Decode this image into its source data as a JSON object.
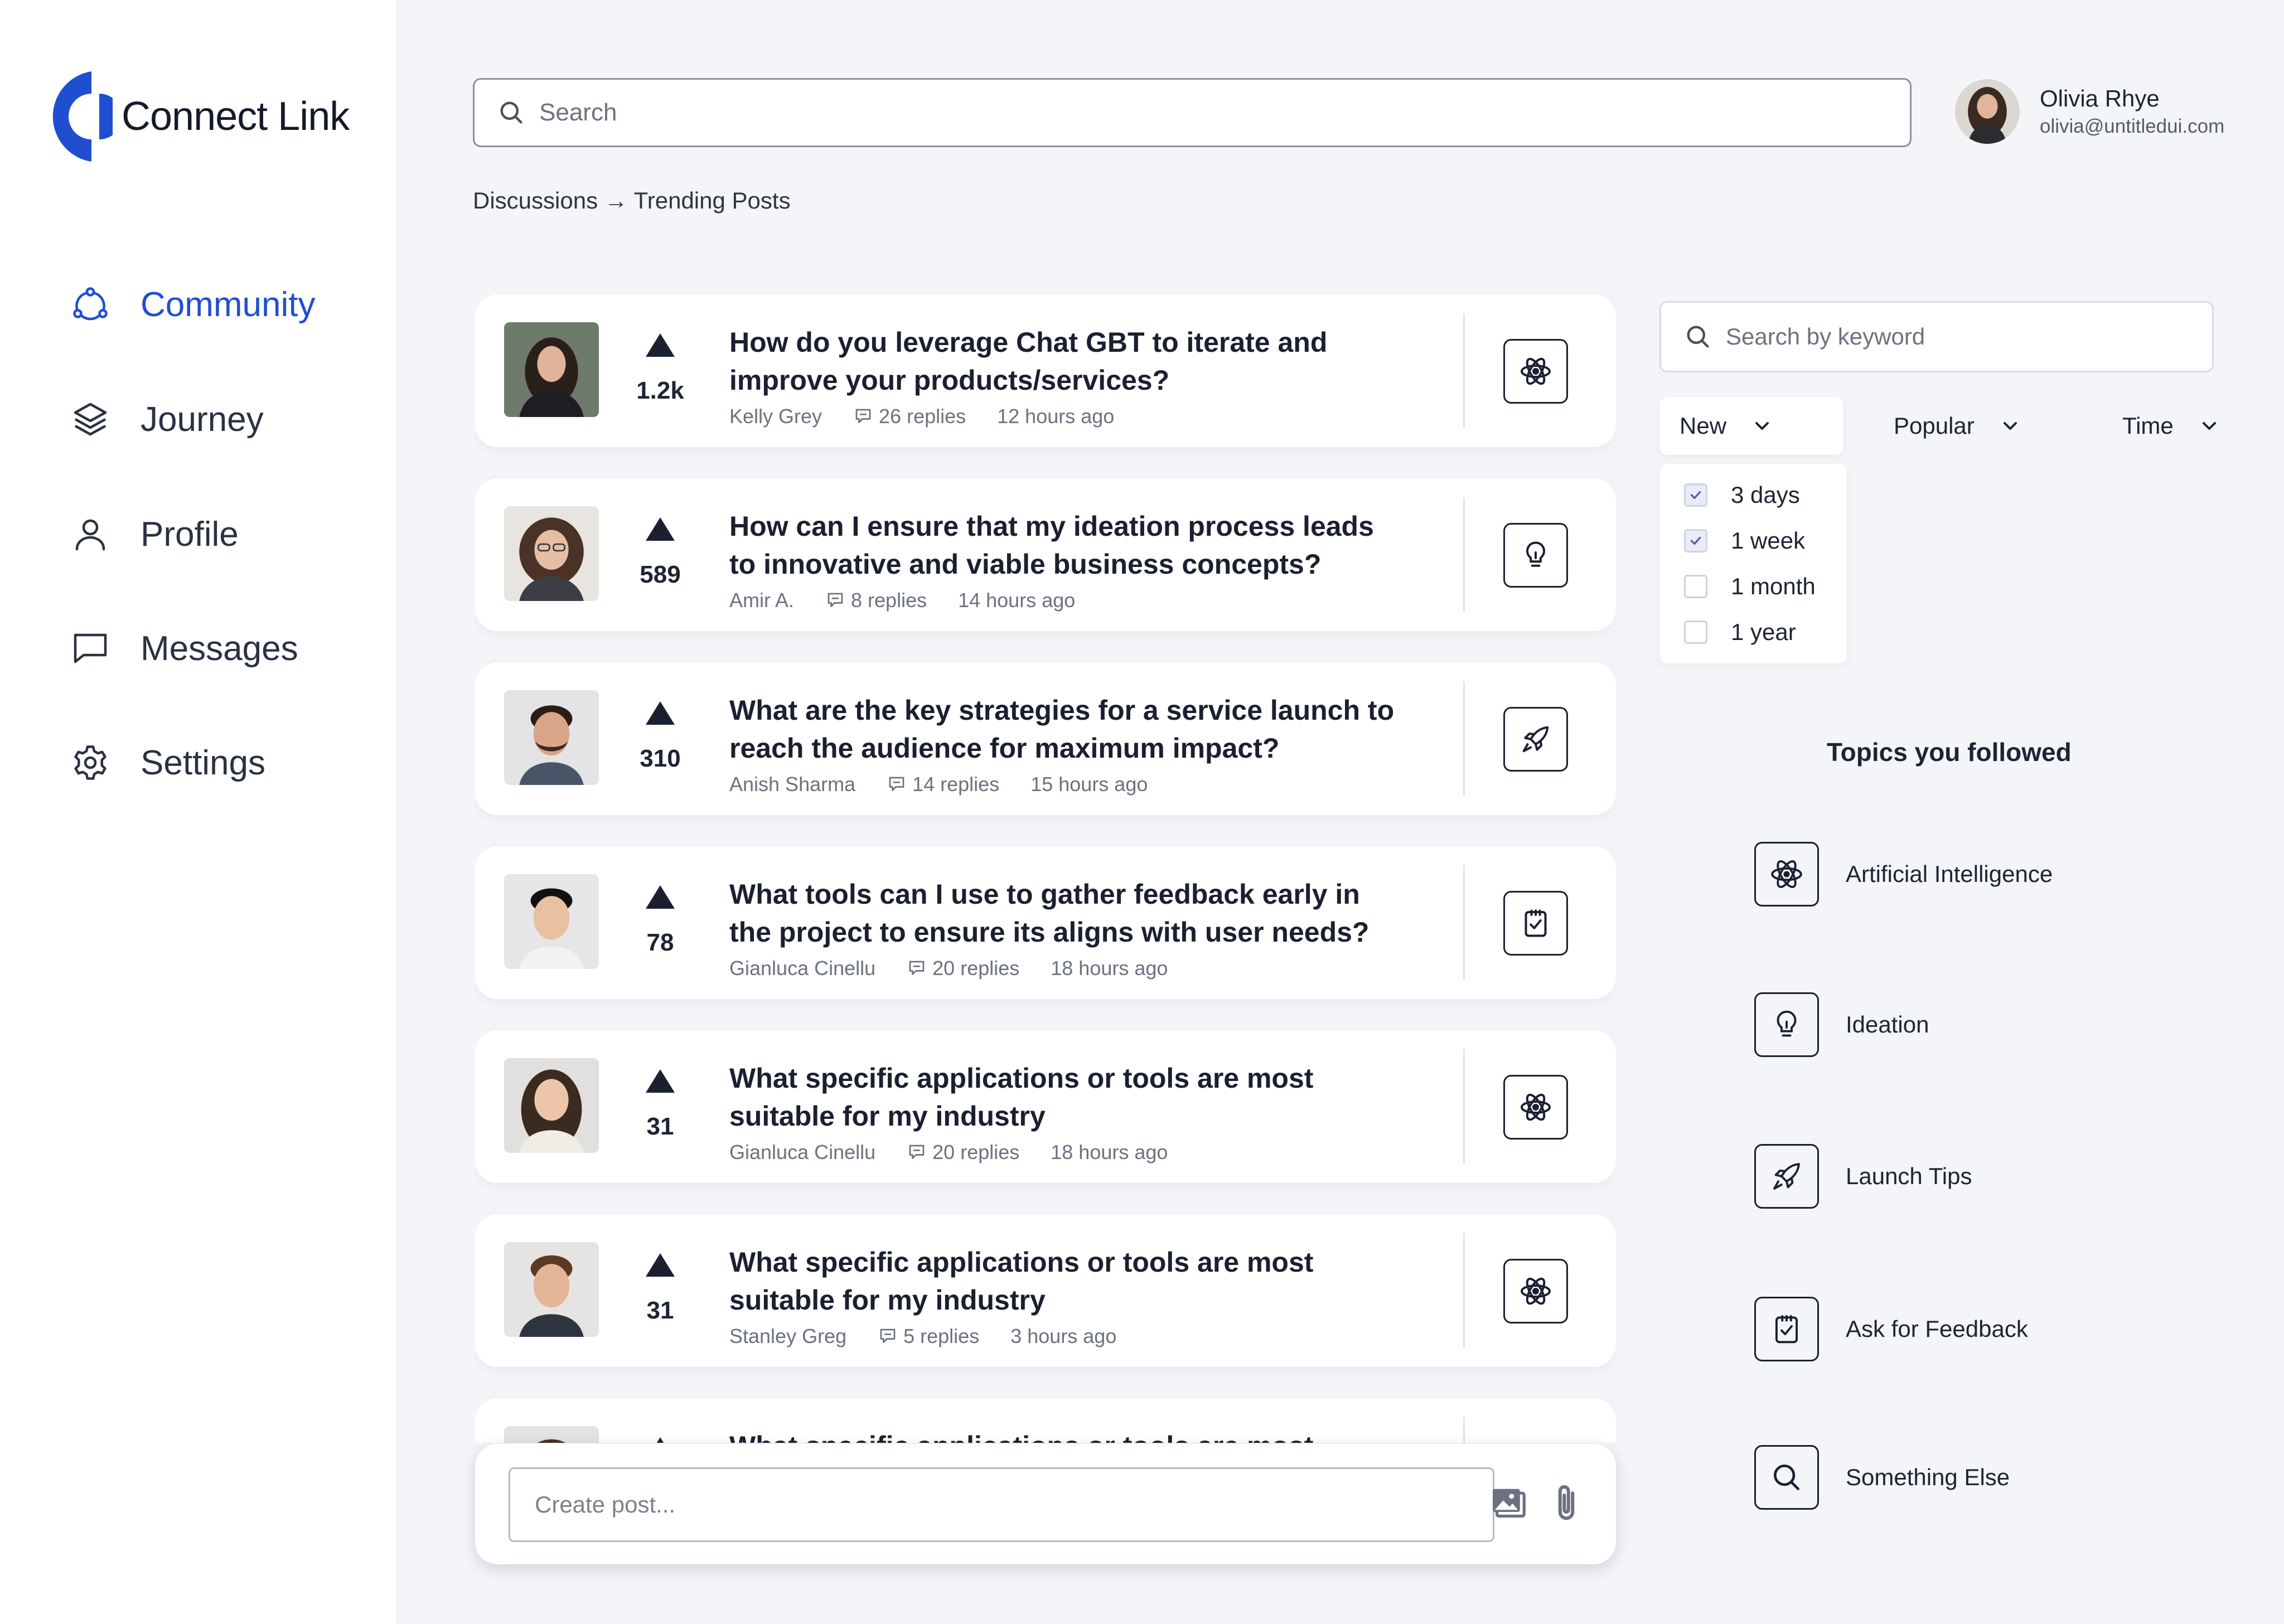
{
  "app": {
    "name": "Connect Link",
    "brand_color": "#1f4fd0"
  },
  "sidebar": {
    "items": [
      {
        "label": "Community",
        "icon": "community-icon",
        "active": true
      },
      {
        "label": "Journey",
        "icon": "layers-icon",
        "active": false
      },
      {
        "label": "Profile",
        "icon": "user-icon",
        "active": false
      },
      {
        "label": "Messages",
        "icon": "message-icon",
        "active": false
      },
      {
        "label": "Settings",
        "icon": "gear-icon",
        "active": false
      }
    ]
  },
  "search": {
    "placeholder": "Search"
  },
  "user": {
    "name": "Olivia Rhye",
    "email": "olivia@untitledui.com"
  },
  "breadcrumb": "Discussions → Trending Posts",
  "posts": [
    {
      "votes": "1.2k",
      "title": "How do you leverage Chat GBT to iterate and improve your products/services?",
      "author": "Kelly Grey",
      "replies": "26 replies",
      "time": "12 hours ago",
      "topic_icon": "atom-icon"
    },
    {
      "votes": "589",
      "title": "How can I ensure that my ideation process leads to innovative and viable business concepts?",
      "author": "Amir A.",
      "replies": "8 replies",
      "time": "14 hours ago",
      "topic_icon": "lightbulb-icon"
    },
    {
      "votes": "310",
      "title": "What are the key strategies for a service launch to reach the audience for maximum impact?",
      "author": "Anish Sharma",
      "replies": "14 replies",
      "time": "15 hours ago",
      "topic_icon": "rocket-icon"
    },
    {
      "votes": "78",
      "title": "What tools can I use to gather feedback early in the project to ensure its aligns with user needs?",
      "author": "Gianluca Cinellu",
      "replies": "20 replies",
      "time": "18 hours ago",
      "topic_icon": "clipboard-check-icon"
    },
    {
      "votes": "31",
      "title": "What specific applications or tools are most suitable for my industry",
      "author": "Gianluca Cinellu",
      "replies": "20 replies",
      "time": "18 hours ago",
      "topic_icon": "atom-icon"
    },
    {
      "votes": "31",
      "title": "What specific applications or tools are most suitable for my industry",
      "author": "Stanley Greg",
      "replies": "5 replies",
      "time": "3 hours ago",
      "topic_icon": "atom-icon"
    },
    {
      "votes": "",
      "title": "What specific applications or tools are most",
      "author": "",
      "replies": "",
      "time": "",
      "topic_icon": "atom-icon"
    }
  ],
  "composer": {
    "placeholder": "Create post..."
  },
  "filters": {
    "keyword_placeholder": "Search by keyword",
    "new_label": "New",
    "popular_label": "Popular",
    "time_label": "Time",
    "time_options": [
      {
        "label": "3 days",
        "checked": true
      },
      {
        "label": "1 week",
        "checked": true
      },
      {
        "label": "1 month",
        "checked": false
      },
      {
        "label": "1 year",
        "checked": false
      }
    ]
  },
  "topics": {
    "heading": "Topics you followed",
    "items": [
      {
        "label": "Artificial Intelligence",
        "icon": "atom-icon"
      },
      {
        "label": "Ideation",
        "icon": "lightbulb-icon"
      },
      {
        "label": "Launch Tips",
        "icon": "rocket-icon"
      },
      {
        "label": "Ask for Feedback",
        "icon": "clipboard-check-icon"
      },
      {
        "label": "Something Else",
        "icon": "search-icon"
      }
    ]
  }
}
